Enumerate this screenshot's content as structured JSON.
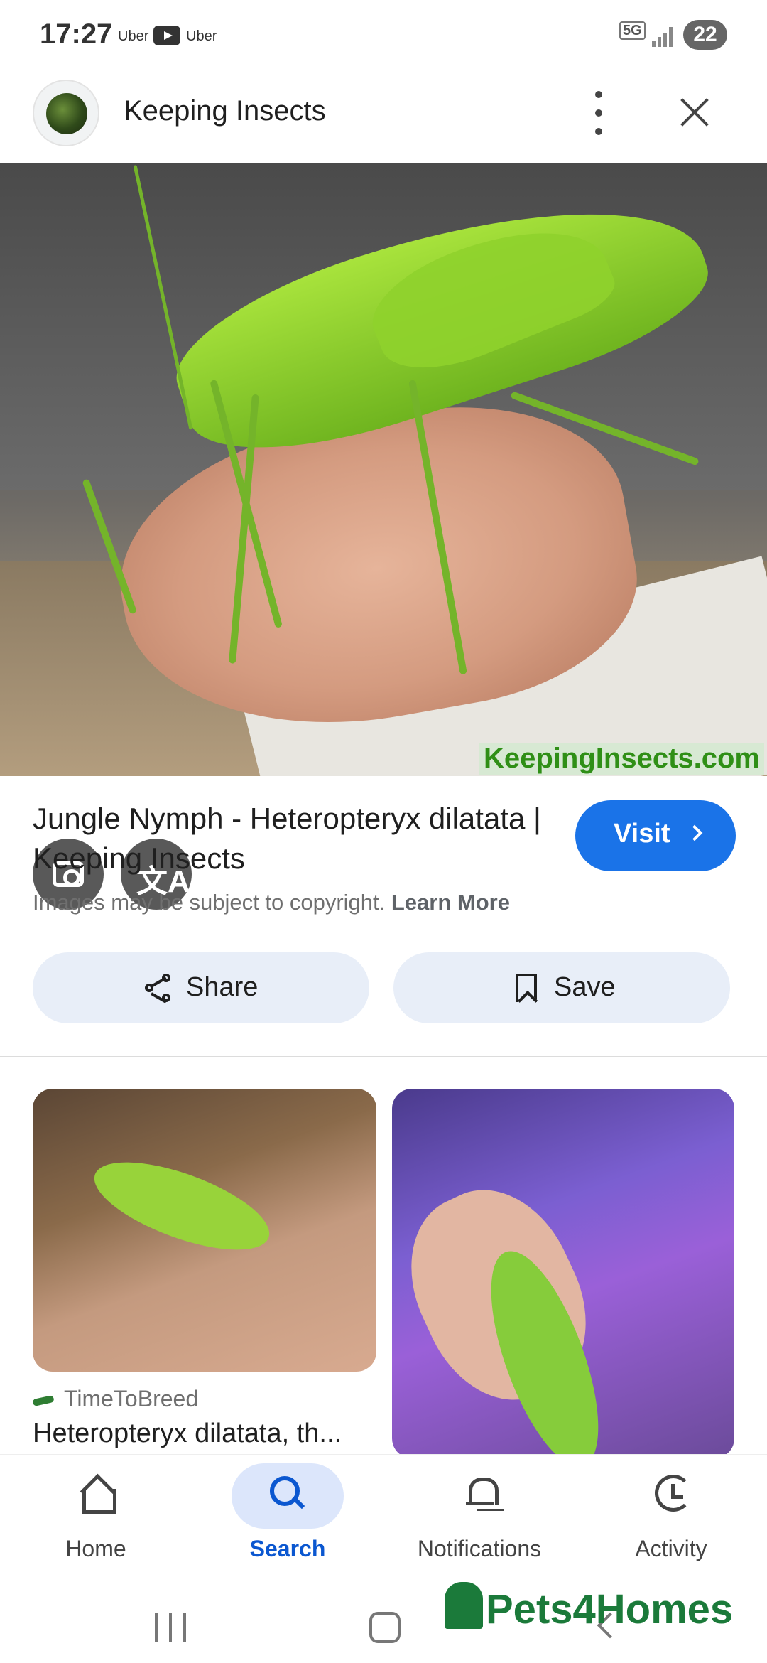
{
  "status_bar": {
    "time": "17:27",
    "apps": [
      "Uber",
      "Uber"
    ],
    "network": "5G",
    "battery": "22"
  },
  "header": {
    "site_name": "Keeping Insects"
  },
  "hero": {
    "watermark": "KeepingInsects.com"
  },
  "result": {
    "title": "Jungle Nymph - Heteropteryx dilatata | Keeping Insects",
    "visit_label": "Visit",
    "copyright_text": "Images may be subject to copyright.",
    "learn_more": "Learn More"
  },
  "actions": {
    "share_label": "Share",
    "save_label": "Save"
  },
  "related": [
    {
      "source": "TimeToBreed",
      "title": "Heteropteryx dilatata, th..."
    }
  ],
  "bottom_nav": [
    {
      "label": "Home",
      "icon": "home-icon"
    },
    {
      "label": "Search",
      "icon": "search-icon",
      "active": true
    },
    {
      "label": "Notifications",
      "icon": "bell-icon"
    },
    {
      "label": "Activity",
      "icon": "activity-icon"
    }
  ],
  "ad": {
    "brand": "Pets4Homes"
  },
  "colors": {
    "accent": "#1a73e8",
    "active_nav": "#0b57d0",
    "pill_bg": "#e8eef8"
  }
}
